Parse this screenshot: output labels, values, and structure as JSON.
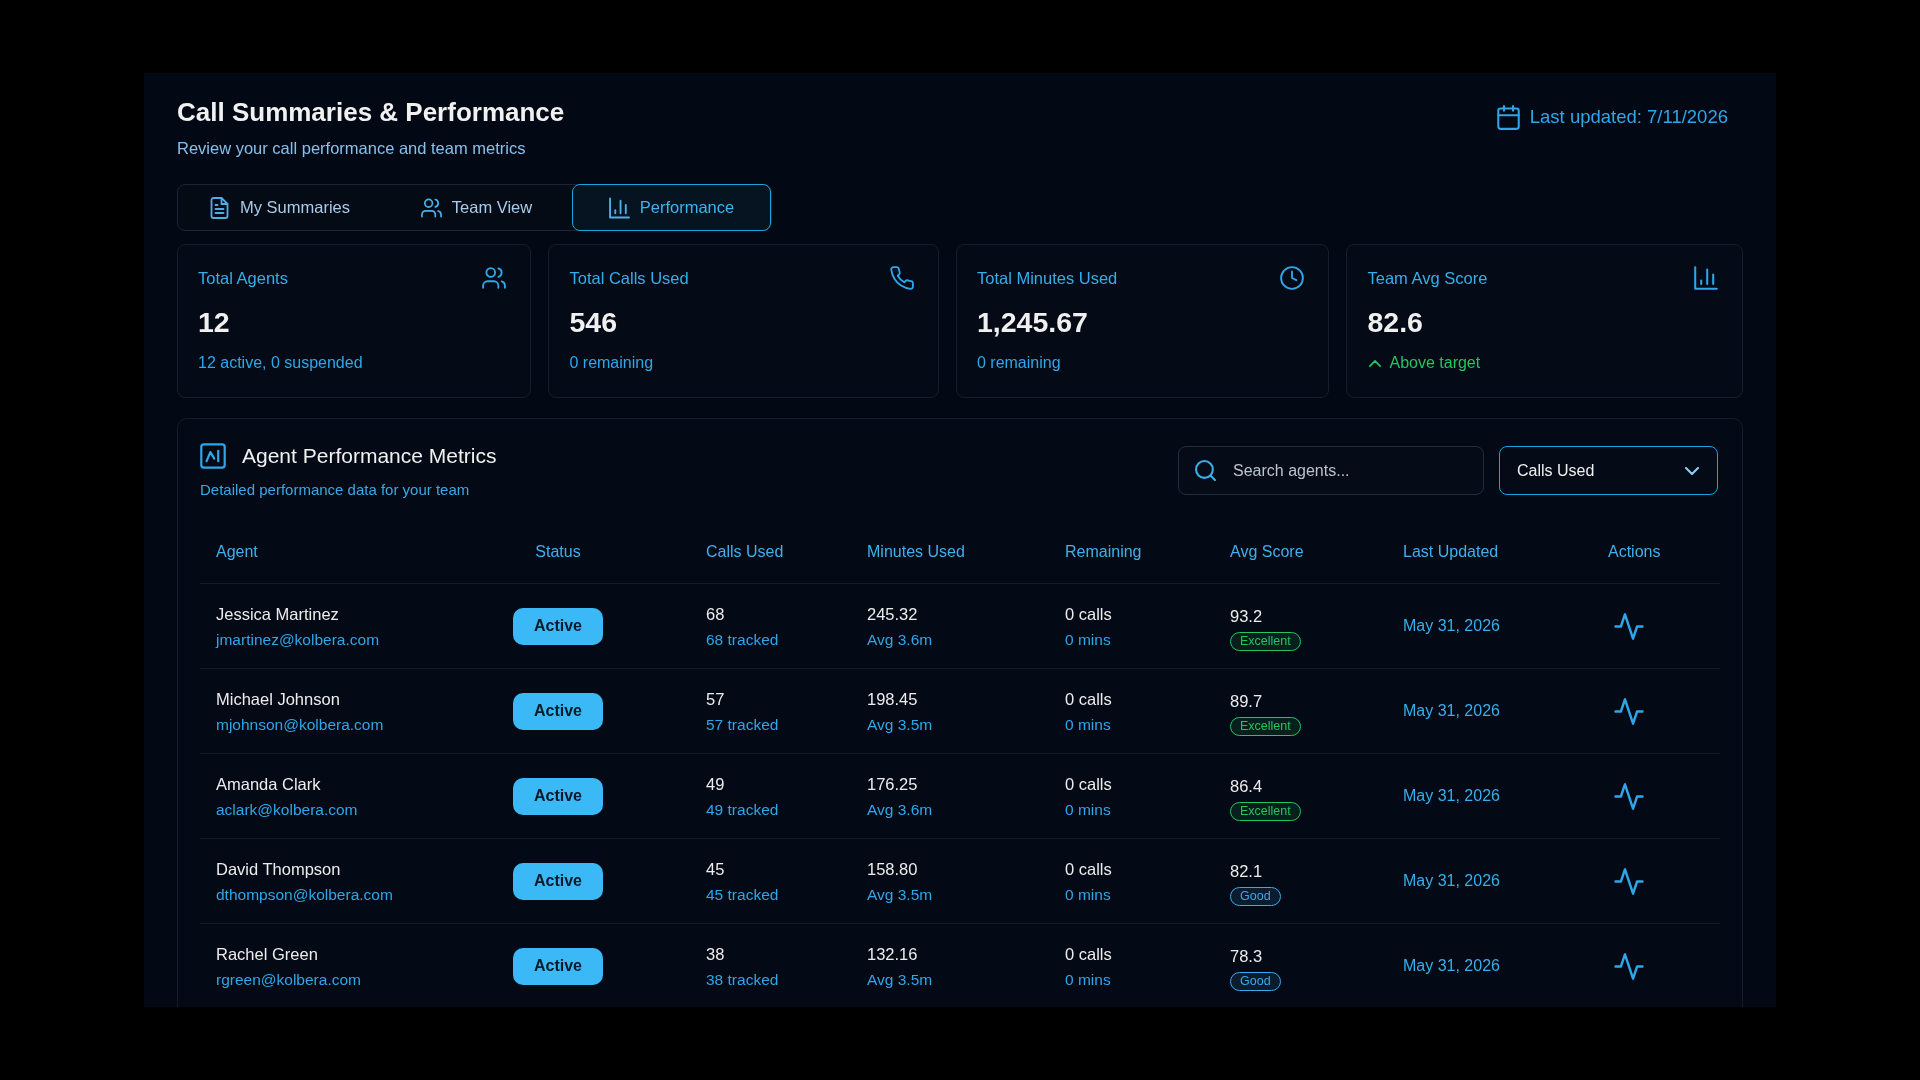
{
  "header": {
    "title": "Call Summaries & Performance",
    "subtitle": "Review your call performance and team metrics",
    "last_updated": "Last updated: 7/11/2026"
  },
  "tabs": [
    {
      "label": "My Summaries",
      "selected": false
    },
    {
      "label": "Team View",
      "selected": false
    },
    {
      "label": "Performance",
      "selected": true
    }
  ],
  "stats": [
    {
      "label": "Total Agents",
      "value": "12",
      "note": "12 active, 0 suspended",
      "kind": "info"
    },
    {
      "label": "Total Calls Used",
      "value": "546",
      "note": "0 remaining",
      "kind": "info"
    },
    {
      "label": "Total Minutes Used",
      "value": "1,245.67",
      "note": "0 remaining",
      "kind": "info"
    },
    {
      "label": "Team Avg Score",
      "value": "82.6",
      "note": "Above target",
      "kind": "up"
    }
  ],
  "metrics": {
    "title": "Agent Performance Metrics",
    "subtitle": "Detailed performance data for your team",
    "search": {
      "placeholder": "Search agents..."
    },
    "sort": {
      "value": "Calls Used"
    },
    "table": {
      "columns": [
        "Agent",
        "Status",
        "Calls Used",
        "Minutes Used",
        "Remaining",
        "Avg Score",
        "Last Updated",
        "Actions"
      ],
      "rows": [
        {
          "name": "Jessica Martinez",
          "email": "jmartinez@kolbera.com",
          "status": "Active",
          "calls": "68",
          "calls_note": "68 tracked",
          "minutes": "245.32",
          "minutes_note": "Avg 3.6m",
          "remaining": "0 calls",
          "remaining_note": "0 mins",
          "score": "93.2",
          "rating": {
            "label": "Excellent",
            "color": "#22c55e"
          },
          "updated": "May 31, 2026"
        },
        {
          "name": "Michael Johnson",
          "email": "mjohnson@kolbera.com",
          "status": "Active",
          "calls": "57",
          "calls_note": "57 tracked",
          "minutes": "198.45",
          "minutes_note": "Avg 3.5m",
          "remaining": "0 calls",
          "remaining_note": "0 mins",
          "score": "89.7",
          "rating": {
            "label": "Excellent",
            "color": "#22c55e"
          },
          "updated": "May 31, 2026"
        },
        {
          "name": "Amanda Clark",
          "email": "aclark@kolbera.com",
          "status": "Active",
          "calls": "49",
          "calls_note": "49 tracked",
          "minutes": "176.25",
          "minutes_note": "Avg 3.6m",
          "remaining": "0 calls",
          "remaining_note": "0 mins",
          "score": "86.4",
          "rating": {
            "label": "Excellent",
            "color": "#22c55e"
          },
          "updated": "May 31, 2026"
        },
        {
          "name": "David Thompson",
          "email": "dthompson@kolbera.com",
          "status": "Active",
          "calls": "45",
          "calls_note": "45 tracked",
          "minutes": "158.80",
          "minutes_note": "Avg 3.5m",
          "remaining": "0 calls",
          "remaining_note": "0 mins",
          "score": "82.1",
          "rating": {
            "label": "Good",
            "color": "#38a9ee"
          },
          "updated": "May 31, 2026"
        },
        {
          "name": "Rachel Green",
          "email": "rgreen@kolbera.com",
          "status": "Active",
          "calls": "38",
          "calls_note": "38 tracked",
          "minutes": "132.16",
          "minutes_note": "Avg 3.5m",
          "remaining": "0 calls",
          "remaining_note": "0 mins",
          "score": "78.3",
          "rating": {
            "label": "Good",
            "color": "#38a9ee"
          },
          "updated": "May 31, 2026"
        }
      ]
    }
  }
}
